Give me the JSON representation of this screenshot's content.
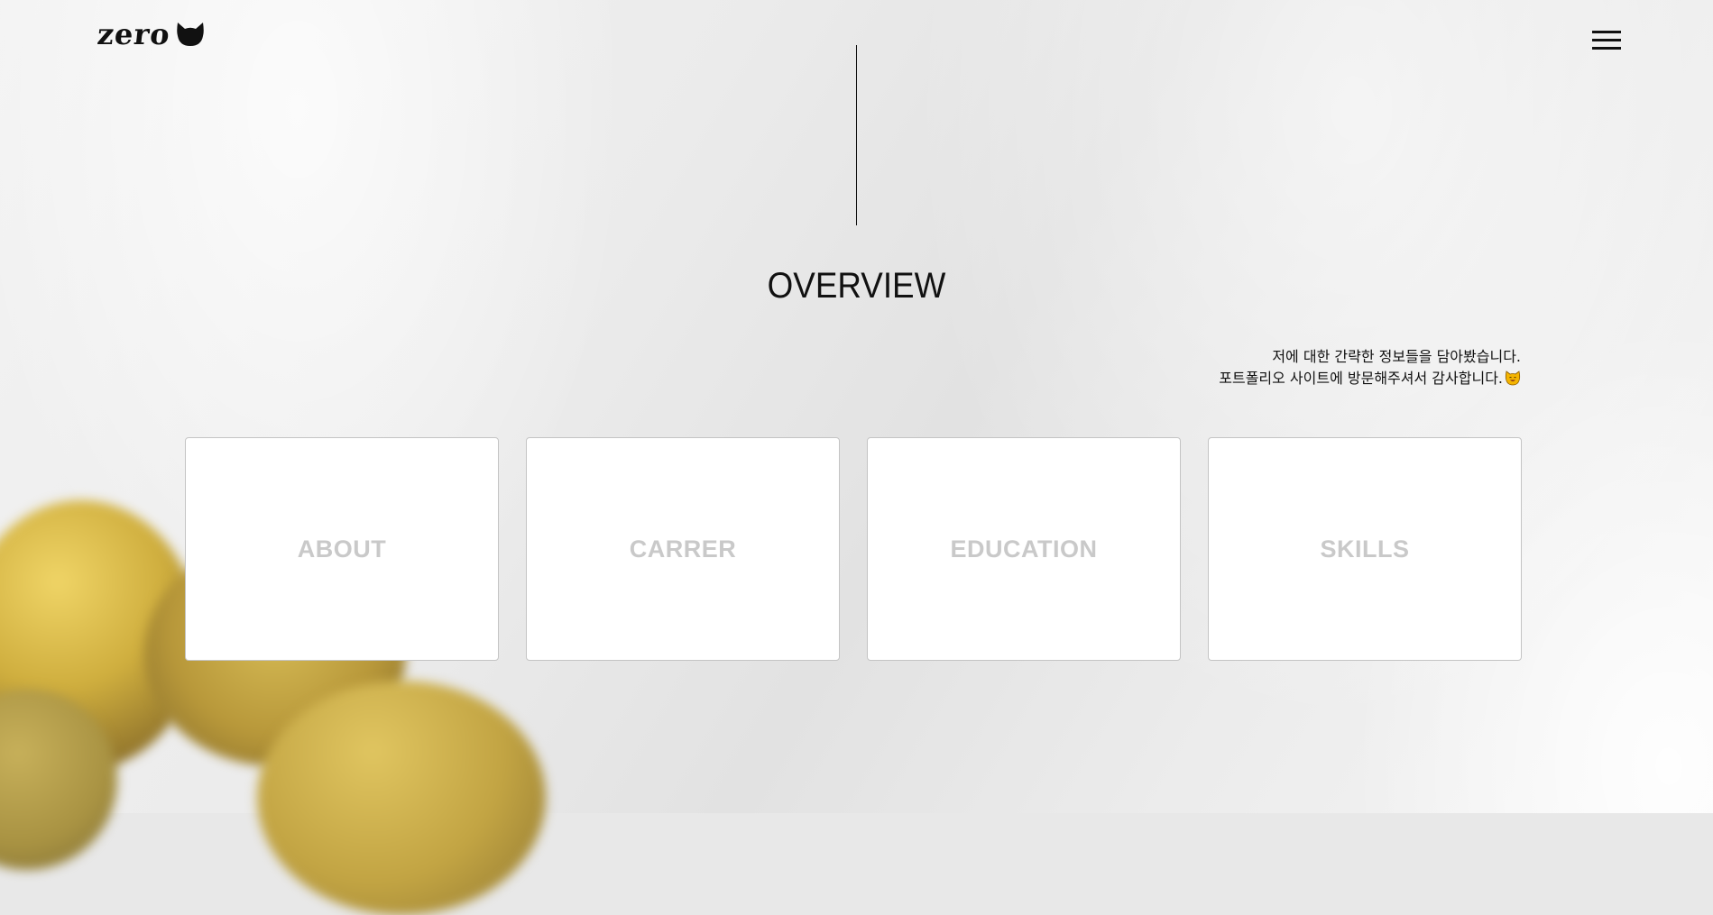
{
  "brand": {
    "logo_text": "zero",
    "logo_icon": "cat-head-icon"
  },
  "header": {
    "menu_icon": "hamburger-menu-icon"
  },
  "section": {
    "title": "OVERVIEW",
    "intro_line_1": "저에 대한 간략한 정보들을 담아봤습니다.",
    "intro_line_2": "포트폴리오 사이트에 방문해주셔서 감사합니다.",
    "intro_emoji": "smiling-cat-emoji"
  },
  "cards": [
    {
      "label": "ABOUT"
    },
    {
      "label": "CARRER"
    },
    {
      "label": "EDUCATION"
    },
    {
      "label": "SKILLS"
    }
  ],
  "colors": {
    "text": "#111111",
    "card_bg": "#ffffff",
    "card_border": "#c4c4c4",
    "card_label": "#c9c9c9"
  }
}
